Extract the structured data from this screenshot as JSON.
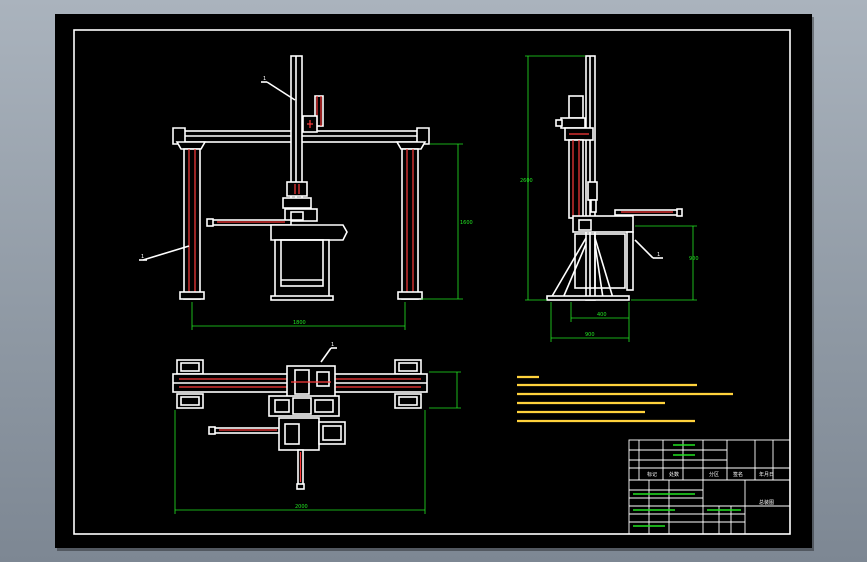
{
  "drawing": {
    "background_color": "#000000",
    "outline_color": "#ffffff",
    "dimension_color": "#22e622",
    "hidden_line_color": "#ff3b3b",
    "note_color": "#ffd23c"
  },
  "balloons": {
    "front_top": "1",
    "front_left": "1",
    "side_right": "1",
    "plan_top": "1"
  },
  "dimensions": {
    "front_width": "1800",
    "front_height": "1600",
    "side_height": "2600",
    "side_base_inner": "400",
    "side_base_outer": "900",
    "side_right_height": "900",
    "plan_width": "2000"
  },
  "title_block": {
    "drawing_name": "总装图",
    "signature_1": "标记",
    "signature_2": "处数",
    "signature_3": "分区",
    "signature_4": "签名",
    "signature_5": "年月日"
  }
}
